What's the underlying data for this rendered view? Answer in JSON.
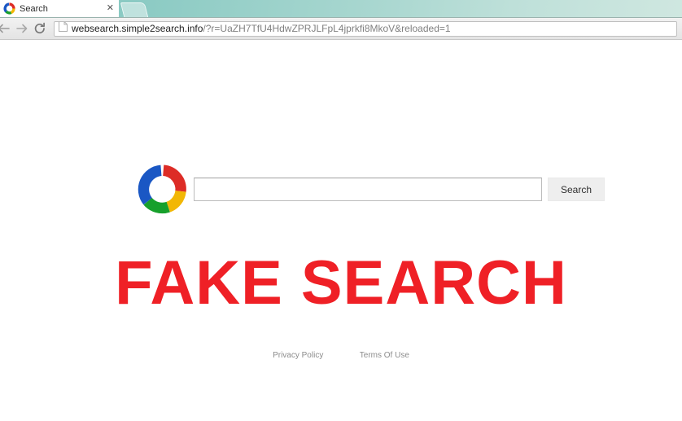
{
  "browser": {
    "tab": {
      "title": "Search",
      "favicon": "multicolor-ring-icon",
      "close_label": "✕"
    },
    "new_tab_label": "",
    "nav": {
      "back_icon": "back-arrow-icon",
      "forward_icon": "forward-arrow-icon",
      "reload_icon": "reload-icon"
    },
    "omnibox": {
      "page_icon": "page-document-icon",
      "url_host": "websearch.simple2search.info",
      "url_path": "/?r=UaZH7TfU4HdwZPRJLFpL4jprkfi8MkoV&reloaded=1",
      "url_full": "websearch.simple2search.info/?r=UaZH7TfU4HdwZPRJLFpL4jprkfi8MkoV&reloaded=1"
    }
  },
  "page": {
    "logo": "multicolor-ring-logo",
    "search": {
      "value": "",
      "placeholder": "",
      "button_label": "Search"
    },
    "headline": "FAKE SEARCH",
    "footer": {
      "privacy_label": "Privacy Policy",
      "terms_label": "Terms Of Use"
    }
  },
  "colors": {
    "headline_red": "#ef2026",
    "tab_strip_teal": "#8fccc5",
    "logo_red": "#dd2c26",
    "logo_yellow": "#f2b705",
    "logo_green": "#17a02c",
    "logo_blue": "#1a57c4",
    "button_bg": "#eeeeee",
    "footer_link": "#8c8c8c"
  }
}
